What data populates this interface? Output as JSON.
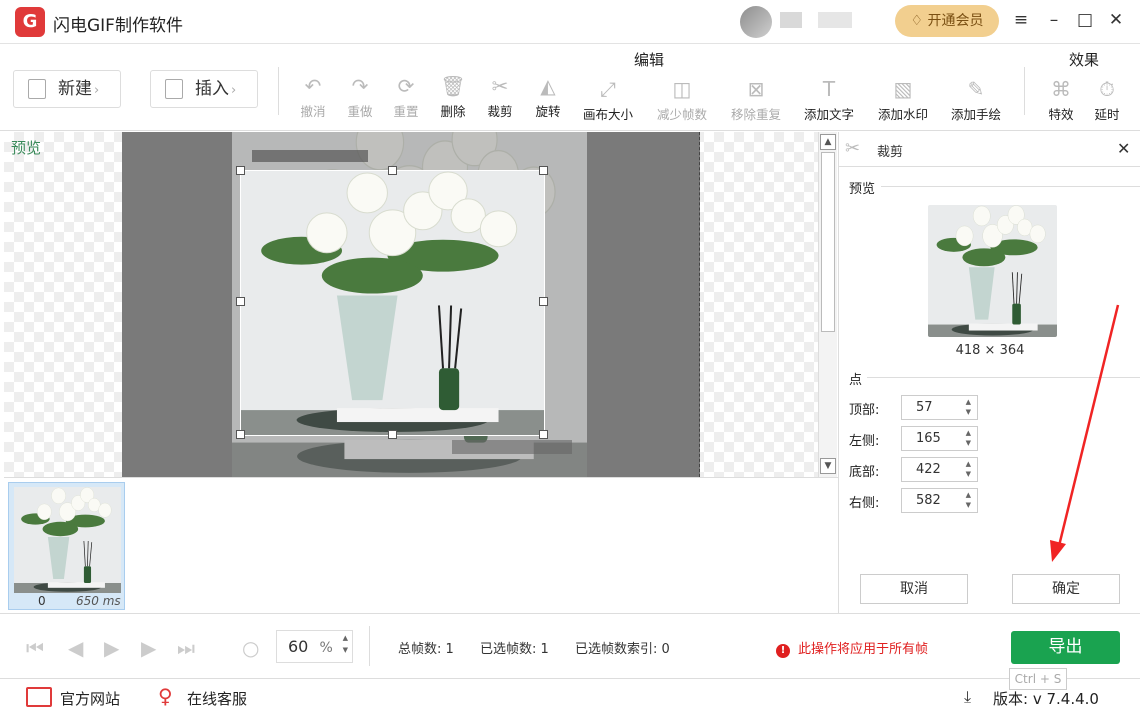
{
  "app": {
    "title": "闪电GIF制作软件",
    "vip_label": "开通会员",
    "logo_letter": "G"
  },
  "toolbar": {
    "new_label": "新建",
    "insert_label": "插入",
    "section_edit": "编辑",
    "section_effect": "效果",
    "tools": [
      {
        "label": "撤消",
        "icon": "↶",
        "enabled": false
      },
      {
        "label": "重做",
        "icon": "↷",
        "enabled": false
      },
      {
        "label": "重置",
        "icon": "⟳",
        "enabled": false
      },
      {
        "label": "删除",
        "icon": "🗑",
        "enabled": true
      },
      {
        "label": "裁剪",
        "icon": "✂",
        "enabled": true
      },
      {
        "label": "旋转",
        "icon": "◭",
        "enabled": true
      },
      {
        "label": "画布大小",
        "icon": "⤢",
        "enabled": true
      },
      {
        "label": "减少帧数",
        "icon": "◫",
        "enabled": false
      },
      {
        "label": "移除重复",
        "icon": "⊠",
        "enabled": false
      },
      {
        "label": "添加文字",
        "icon": "T",
        "enabled": true
      },
      {
        "label": "添加水印",
        "icon": "▧",
        "enabled": true
      },
      {
        "label": "添加手绘",
        "icon": "✎",
        "enabled": true
      },
      {
        "label": "特效",
        "icon": "⌘",
        "enabled": true
      },
      {
        "label": "延时",
        "icon": "⏱",
        "enabled": true
      }
    ]
  },
  "canvas": {
    "preview_label": "预览"
  },
  "crop_panel": {
    "title": "裁剪",
    "preview_label": "预览",
    "size_text": "418 × 364",
    "points_label": "点",
    "fields": [
      {
        "label": "顶部:",
        "value": "57"
      },
      {
        "label": "左侧:",
        "value": "165"
      },
      {
        "label": "底部:",
        "value": "422"
      },
      {
        "label": "右侧:",
        "value": "582"
      }
    ],
    "cancel_label": "取消",
    "ok_label": "确定"
  },
  "frames": [
    {
      "index": "0",
      "duration": "650 ms"
    }
  ],
  "controls": {
    "zoom_value": "60",
    "zoom_unit": "%",
    "total_frames": "总帧数: 1",
    "selected_frames": "已选帧数: 1",
    "selected_index": "已选帧数索引: 0",
    "warning": "此操作将应用于所有帧",
    "export_label": "导出",
    "export_shortcut": "Ctrl + S"
  },
  "footer": {
    "website": "官方网站",
    "support": "在线客服",
    "version": "版本: v 7.4.4.0"
  },
  "colors": {
    "accent_green": "#1aa350",
    "warning_red": "#e02020",
    "vip_gold": "#f2cf8f",
    "logo_red": "#e03a3a"
  }
}
